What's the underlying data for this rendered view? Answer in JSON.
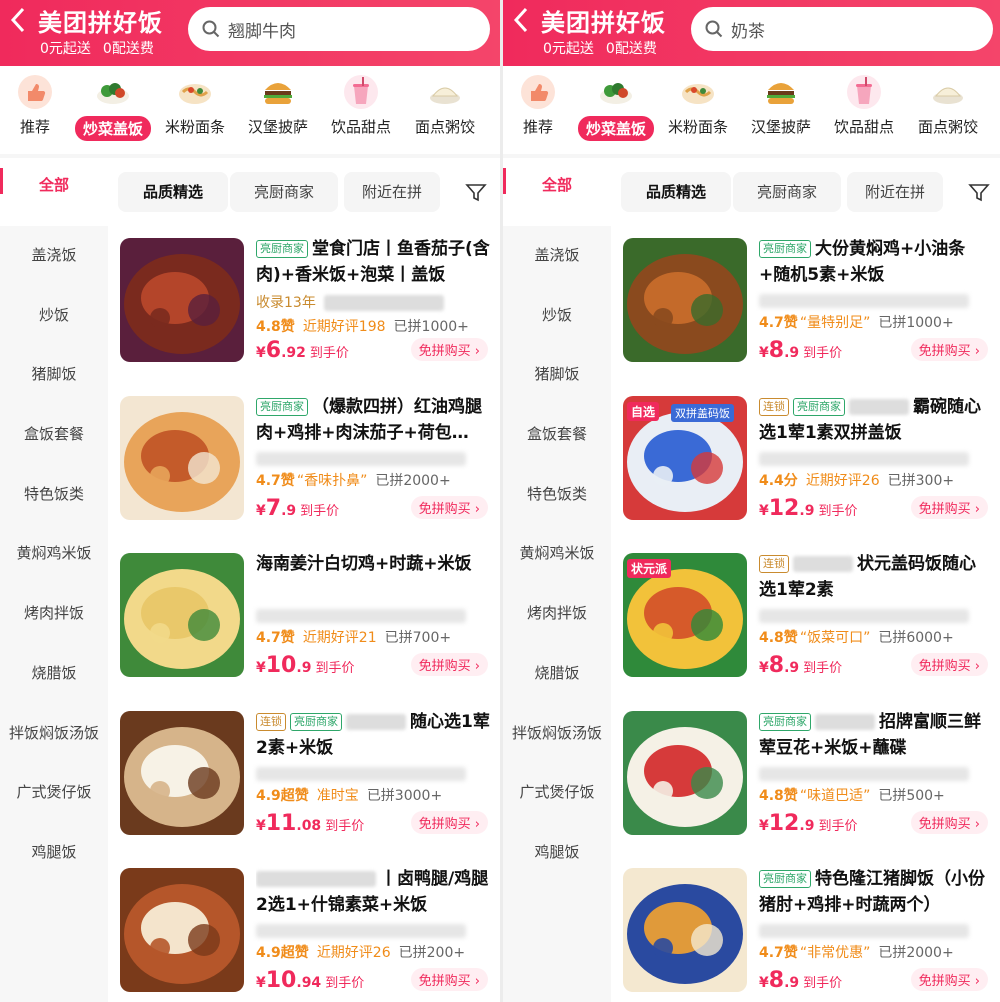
{
  "colors": {
    "brand": "#f02a5c",
    "accent": "#f08c1a",
    "merchant_tag": "#2fa76a",
    "chain_tag": "#c98b2f"
  },
  "left": {
    "header": {
      "back_icon": "chevron-left-icon",
      "title": "美团拼好饭",
      "promo": [
        "0元起送",
        "0配送费"
      ],
      "search_text": "翘脚牛肉"
    },
    "categories": [
      {
        "label": "推荐",
        "icon": "thumbs-up-icon",
        "active": false
      },
      {
        "label": "炒菜盖饭",
        "icon": "stir-fry-icon",
        "active": true
      },
      {
        "label": "米粉面条",
        "icon": "noodle-icon",
        "active": false
      },
      {
        "label": "汉堡披萨",
        "icon": "burger-icon",
        "active": false
      },
      {
        "label": "饮品甜点",
        "icon": "drink-icon",
        "active": false
      },
      {
        "label": "面点粥饺",
        "icon": "dumpling-icon",
        "active": false
      }
    ],
    "filters": {
      "all": "全部",
      "chips": [
        "品质精选",
        "亮厨商家",
        "附近在拼"
      ],
      "selected": "品质精选"
    },
    "sidebar": [
      "盖浇饭",
      "炒饭",
      "猪脚饭",
      "盒饭套餐",
      "特色饭类",
      "黄焖鸡米饭",
      "烤肉拌饭",
      "烧腊饭",
      "拌饭焖饭汤饭",
      "广式煲仔饭",
      "鸡腿饭"
    ],
    "items": [
      {
        "tags": [
          {
            "text": "亮厨商家",
            "kind": "merchant"
          }
        ],
        "title": "堂食门店丨鱼香茄子(含肉)+香米饭+泡菜丨盖饭",
        "extra": "收录13年",
        "score": "4.8赞",
        "review": "近期好评198",
        "quote": "",
        "sold": "已拼1000+",
        "price_symbol": "¥",
        "price_main": "6",
        "price_dec": ".92",
        "price_label": "到手价",
        "buy": "免拼购买 ›",
        "thumb": [
          "#7a2a1e",
          "#b4452a",
          "#5a1f3c"
        ]
      },
      {
        "tags": [
          {
            "text": "亮厨商家",
            "kind": "merchant"
          }
        ],
        "title": "（爆款四拼）红油鸡腿肉+鸡排+肉沫茄子+荷包…",
        "extra": "",
        "score": "4.7赞",
        "review": "",
        "quote": "“香味扑鼻”",
        "sold": "已拼2000+",
        "price_symbol": "¥",
        "price_main": "7",
        "price_dec": ".9",
        "price_label": "到手价",
        "buy": "免拼购买 ›",
        "thumb": [
          "#e8a45a",
          "#c45b2a",
          "#f3e6d2"
        ]
      },
      {
        "tags": [],
        "title": "海南姜汁白切鸡+时蔬+米饭",
        "extra": "",
        "score": "4.7赞",
        "review": "近期好评21",
        "quote": "",
        "sold": "已拼700+",
        "price_symbol": "¥",
        "price_main": "10",
        "price_dec": ".9",
        "price_label": "到手价",
        "buy": "免拼购买 ›",
        "thumb": [
          "#f2d98a",
          "#e9c86a",
          "#3f8a3a"
        ]
      },
      {
        "tags": [
          {
            "text": "连锁",
            "kind": "chain"
          },
          {
            "text": "亮厨商家",
            "kind": "merchant"
          }
        ],
        "title": "随心选1荤2素+米饭",
        "extra": "",
        "score": "4.9超赞",
        "review": "准时宝",
        "quote": "",
        "sold": "已拼3000+",
        "price_symbol": "¥",
        "price_main": "11",
        "price_dec": ".08",
        "price_label": "到手价",
        "buy": "免拼购买 ›",
        "thumb": [
          "#d6b48a",
          "#f7f2e6",
          "#6a3a1e"
        ]
      },
      {
        "tags": [],
        "title": "丨卤鸭腿/鸡腿2选1+什锦素菜+米饭",
        "extra": "",
        "score": "4.9超赞",
        "review": "近期好评26",
        "quote": "",
        "sold": "已拼200+",
        "price_symbol": "¥",
        "price_main": "10",
        "price_dec": ".94",
        "price_label": "到手价",
        "buy": "免拼购买 ›",
        "thumb": [
          "#b5562a",
          "#f4e4cc",
          "#7a3a1a"
        ]
      }
    ]
  },
  "right": {
    "header": {
      "back_icon": "chevron-left-icon",
      "title": "美团拼好饭",
      "promo": [
        "0元起送",
        "0配送费"
      ],
      "search_text": "奶茶"
    },
    "categories": [
      {
        "label": "推荐",
        "icon": "thumbs-up-icon",
        "active": false
      },
      {
        "label": "炒菜盖饭",
        "icon": "stir-fry-icon",
        "active": true
      },
      {
        "label": "米粉面条",
        "icon": "noodle-icon",
        "active": false
      },
      {
        "label": "汉堡披萨",
        "icon": "burger-icon",
        "active": false
      },
      {
        "label": "饮品甜点",
        "icon": "drink-icon",
        "active": false
      },
      {
        "label": "面点粥饺",
        "icon": "dumpling-icon",
        "active": false
      }
    ],
    "filters": {
      "all": "全部",
      "chips": [
        "品质精选",
        "亮厨商家",
        "附近在拼"
      ],
      "selected": "品质精选"
    },
    "sidebar": [
      "盖浇饭",
      "炒饭",
      "猪脚饭",
      "盒饭套餐",
      "特色饭类",
      "黄焖鸡米饭",
      "烤肉拌饭",
      "烧腊饭",
      "拌饭焖饭汤饭",
      "广式煲仔饭",
      "鸡腿饭"
    ],
    "items": [
      {
        "tags": [
          {
            "text": "亮厨商家",
            "kind": "merchant"
          }
        ],
        "title": "大份黄焖鸡+小油条+随机5素+米饭",
        "extra": "",
        "score": "4.7赞",
        "review": "",
        "quote": "“量特别足”",
        "sold": "已拼1000+",
        "price_symbol": "¥",
        "price_main": "8",
        "price_dec": ".9",
        "price_label": "到手价",
        "buy": "免拼购买 ›",
        "thumb": [
          "#8a4a1e",
          "#c46a2a",
          "#3a6a2a"
        ]
      },
      {
        "tags": [
          {
            "text": "连锁",
            "kind": "chain"
          },
          {
            "text": "亮厨商家",
            "kind": "merchant"
          }
        ],
        "title": "霸碗随心选1荤1素双拼盖饭",
        "extra": "",
        "score": "4.4分",
        "review": "近期好评26",
        "quote": "",
        "sold": "已拼300+",
        "price_symbol": "¥",
        "price_main": "12",
        "price_dec": ".9",
        "price_label": "到手价",
        "buy": "免拼购买 ›",
        "thumb": [
          "#e9eef5",
          "#3a6ad6",
          "#d63a3a"
        ],
        "badge_left": "自选",
        "badge_right": "双拼盖码饭"
      },
      {
        "tags": [
          {
            "text": "连锁",
            "kind": "chain"
          }
        ],
        "title": "状元盖码饭随心选1荤2素",
        "extra": "",
        "score": "4.8赞",
        "review": "",
        "quote": "“饭菜可口”",
        "sold": "已拼6000+",
        "price_symbol": "¥",
        "price_main": "8",
        "price_dec": ".9",
        "price_label": "到手价",
        "buy": "免拼购买 ›",
        "thumb": [
          "#f2c23a",
          "#d65a2a",
          "#2f8a3a"
        ],
        "badge_left": "状元派"
      },
      {
        "tags": [
          {
            "text": "亮厨商家",
            "kind": "merchant"
          }
        ],
        "title": "招牌富顺三鲜荤豆花+米饭+蘸碟",
        "extra": "",
        "score": "4.8赞",
        "review": "",
        "quote": "“味道巴适”",
        "sold": "已拼500+",
        "price_symbol": "¥",
        "price_main": "12",
        "price_dec": ".9",
        "price_label": "到手价",
        "buy": "免拼购买 ›",
        "thumb": [
          "#f5f1e6",
          "#d63a3a",
          "#3a8a4a"
        ]
      },
      {
        "tags": [
          {
            "text": "亮厨商家",
            "kind": "merchant"
          }
        ],
        "title": "特色隆江猪脚饭（小份猪肘+鸡排+时蔬两个）",
        "extra": "",
        "score": "4.7赞",
        "review": "",
        "quote": "“非常优惠”",
        "sold": "已拼2000+",
        "price_symbol": "¥",
        "price_main": "8",
        "price_dec": ".9",
        "price_label": "到手价",
        "buy": "免拼购买 ›",
        "thumb": [
          "#2a4aa0",
          "#e09a3a",
          "#f4e8d0"
        ]
      }
    ]
  }
}
